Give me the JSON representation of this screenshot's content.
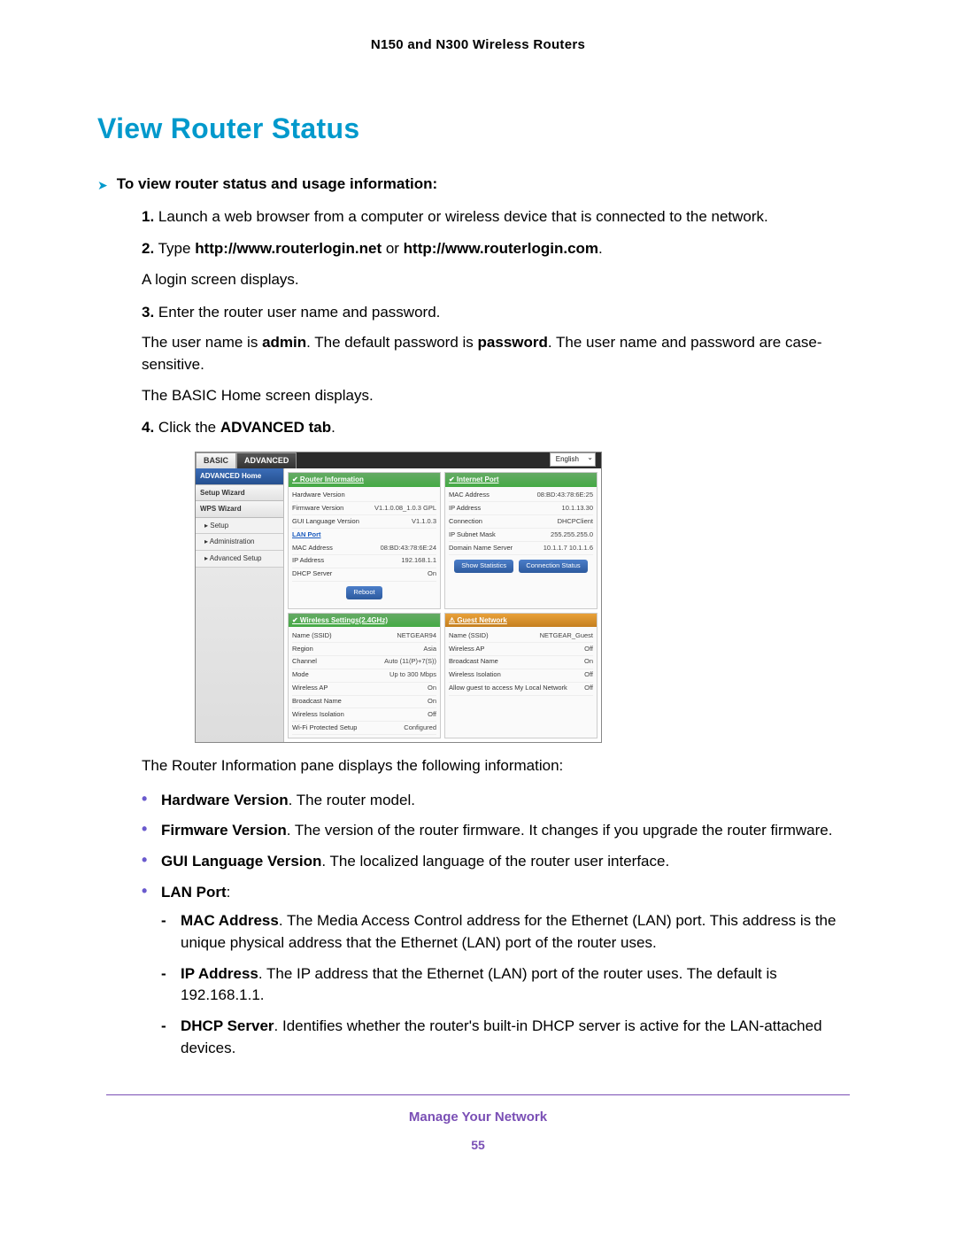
{
  "header": "N150 and N300 Wireless Routers",
  "title": "View Router Status",
  "lead": "To view router status and usage information:",
  "steps": {
    "s1": {
      "num": "1.",
      "text": "Launch a web browser from a computer or wireless device that is connected to the network."
    },
    "s2": {
      "num": "2.",
      "pre": "Type ",
      "b1": "http://www.routerlogin.net",
      "mid": " or ",
      "b2": "http://www.routerlogin.com",
      "post": ".",
      "after": "A login screen displays."
    },
    "s3": {
      "num": "3.",
      "text": "Enter the router user name and password.",
      "p1a": "The user name is ",
      "p1b": "admin",
      "p1c": ". The default password is ",
      "p1d": "password",
      "p1e": ". The user name and password are case-sensitive.",
      "p2": "The BASIC Home screen displays."
    },
    "s4": {
      "num": "4.",
      "pre": "Click the ",
      "b": "ADVANCED tab",
      "post": "."
    }
  },
  "screenshot": {
    "lang": "English",
    "tabs": {
      "basic": "BASIC",
      "advanced": "ADVANCED"
    },
    "nav": {
      "home": "ADVANCED Home",
      "setup_wizard": "Setup Wizard",
      "wps_wizard": "WPS Wizard",
      "setup": "▸ Setup",
      "admin": "▸ Administration",
      "adv": "▸ Advanced Setup"
    },
    "router_info": {
      "title": "✔ Router Information",
      "rows": {
        "hw": {
          "k": "Hardware Version",
          "v": ""
        },
        "fw": {
          "k": "Firmware Version",
          "v": "V1.1.0.08_1.0.3  GPL"
        },
        "gui": {
          "k": "GUI Language Version",
          "v": "V1.1.0.3"
        }
      },
      "lan_hd": "LAN Port",
      "lan": {
        "mac": {
          "k": "MAC Address",
          "v": "08:BD:43:78:6E:24"
        },
        "ip": {
          "k": "IP Address",
          "v": "192.168.1.1"
        },
        "dhcp": {
          "k": "DHCP Server",
          "v": "On"
        }
      },
      "btn": "Reboot"
    },
    "internet_port": {
      "title": "✔ Internet Port",
      "rows": {
        "mac": {
          "k": "MAC Address",
          "v": "08:BD:43:78:6E:25"
        },
        "ip": {
          "k": "IP Address",
          "v": "10.1.13.30"
        },
        "conn": {
          "k": "Connection",
          "v": "DHCPClient"
        },
        "mask": {
          "k": "IP Subnet Mask",
          "v": "255.255.255.0"
        },
        "dns": {
          "k": "Domain Name Server",
          "v": "10.1.1.7 10.1.1.6"
        }
      },
      "btn1": "Show Statistics",
      "btn2": "Connection Status"
    },
    "wireless": {
      "title": "✔ Wireless Settings(2.4GHz)",
      "rows": {
        "ssid": {
          "k": "Name (SSID)",
          "v": "NETGEAR94"
        },
        "region": {
          "k": "Region",
          "v": "Asia"
        },
        "channel": {
          "k": "Channel",
          "v": "Auto (11(P)+7(S))"
        },
        "mode": {
          "k": "Mode",
          "v": "Up to 300 Mbps"
        },
        "ap": {
          "k": "Wireless AP",
          "v": "On"
        },
        "bcast": {
          "k": "Broadcast Name",
          "v": "On"
        },
        "iso": {
          "k": "Wireless Isolation",
          "v": "Off"
        },
        "wps": {
          "k": "Wi-Fi Protected Setup",
          "v": "Configured"
        }
      }
    },
    "guest": {
      "title": "⚠ Guest Network",
      "rows": {
        "ssid": {
          "k": "Name (SSID)",
          "v": "NETGEAR_Guest"
        },
        "ap": {
          "k": "Wireless AP",
          "v": "Off"
        },
        "bcast": {
          "k": "Broadcast Name",
          "v": "On"
        },
        "iso": {
          "k": "Wireless Isolation",
          "v": "Off"
        },
        "allow": {
          "k": "Allow guest to access My Local Network",
          "v": "Off"
        }
      }
    }
  },
  "info_intro": "The Router Information pane displays the following information:",
  "info": {
    "hw": {
      "b": "Hardware Version",
      "t": ". The router model."
    },
    "fw": {
      "b": "Firmware Version",
      "t": ". The version of the router firmware. It changes if you upgrade the router firmware."
    },
    "gui": {
      "b": "GUI Language Version",
      "t": ". The localized language of the router user interface."
    },
    "lan": {
      "b": "LAN Port",
      "t": ":"
    },
    "mac": {
      "b": "MAC Address",
      "t": ". The Media Access Control address for the Ethernet (LAN) port. This address is the unique physical address that the Ethernet (LAN) port of the router uses."
    },
    "ip": {
      "b": "IP Address",
      "t": ". The IP address that the Ethernet (LAN) port of the router uses. The default is 192.168.1.1."
    },
    "dhcp": {
      "b": "DHCP Server",
      "t": ". Identifies whether the router's built-in DHCP server is active for the LAN-attached devices."
    }
  },
  "footer": {
    "title": "Manage Your Network",
    "page": "55"
  }
}
